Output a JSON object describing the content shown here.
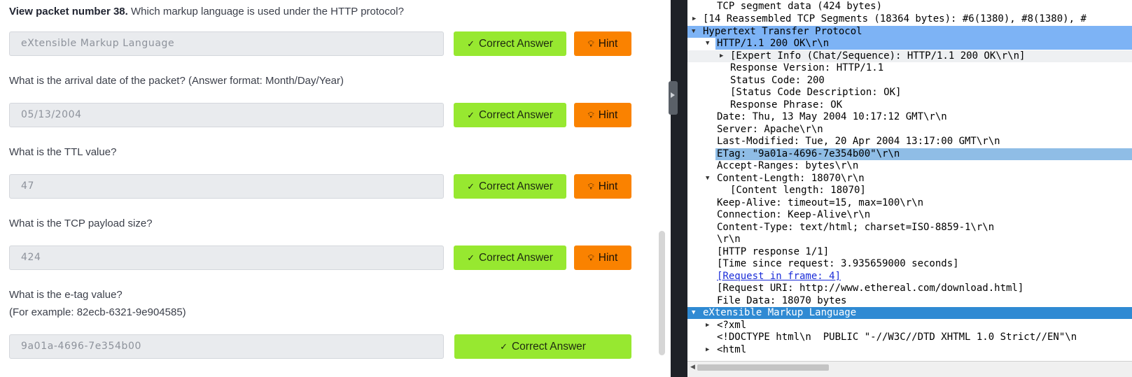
{
  "questions": [
    {
      "prefix": "View packet number 38.",
      "text": " Which markup language is used under the HTTP protocol?",
      "answer": "eXtensible Markup Language",
      "correct_label": "Correct Answer",
      "hint_label": "Hint"
    },
    {
      "text": "What is the arrival date of the packet? (Answer format: Month/Day/Year)",
      "answer": "05/13/2004",
      "correct_label": "Correct Answer",
      "hint_label": "Hint"
    },
    {
      "text": "What is the TTL value?",
      "answer": "47",
      "correct_label": "Correct Answer",
      "hint_label": "Hint"
    },
    {
      "text": "What is the TCP payload size?",
      "answer": "424",
      "correct_label": "Correct Answer",
      "hint_label": "Hint"
    },
    {
      "text": "What is the e-tag value?",
      "subtext": "(For example: 82ecb-6321-9e904585)",
      "answer": "9a01a-4696-7e354b00",
      "correct_label": "Correct Answer"
    }
  ],
  "icons": {
    "check": "check-icon",
    "bulb": "lightbulb-icon",
    "expanded": "triangle-down-icon",
    "collapsed": "triangle-right-icon"
  },
  "colors": {
    "correct": "#97e830",
    "hint": "#fa8200",
    "http_highlight": "#7db3f5",
    "selected": "#8fbde6",
    "xml_highlight": "#2f8ad3"
  },
  "packet_tree": [
    {
      "text": "TCP segment data (424 bytes)"
    },
    {
      "text": "[14 Reassembled TCP Segments (18364 bytes): #6(1380), #8(1380), #"
    },
    {
      "text": "Hypertext Transfer Protocol"
    },
    {
      "text": "HTTP/1.1 200 OK\\r\\n"
    },
    {
      "text": "[Expert Info (Chat/Sequence): HTTP/1.1 200 OK\\r\\n]"
    },
    {
      "text": "Response Version: HTTP/1.1"
    },
    {
      "text": "Status Code: 200"
    },
    {
      "text": "[Status Code Description: OK]"
    },
    {
      "text": "Response Phrase: OK"
    },
    {
      "text": "Date: Thu, 13 May 2004 10:17:12 GMT\\r\\n"
    },
    {
      "text": "Server: Apache\\r\\n"
    },
    {
      "text": "Last-Modified: Tue, 20 Apr 2004 13:17:00 GMT\\r\\n"
    },
    {
      "text": "ETag: \"9a01a-4696-7e354b00\"\\r\\n"
    },
    {
      "text": "Accept-Ranges: bytes\\r\\n"
    },
    {
      "text": "Content-Length: 18070\\r\\n"
    },
    {
      "text": "[Content length: 18070]"
    },
    {
      "text": "Keep-Alive: timeout=15, max=100\\r\\n"
    },
    {
      "text": "Connection: Keep-Alive\\r\\n"
    },
    {
      "text": "Content-Type: text/html; charset=ISO-8859-1\\r\\n"
    },
    {
      "text": "\\r\\n"
    },
    {
      "text": "[HTTP response 1/1]"
    },
    {
      "text": "[Time since request: 3.935659000 seconds]"
    },
    {
      "text": "[Request in frame: 4]"
    },
    {
      "text": "[Request URI: http://www.ethereal.com/download.html]"
    },
    {
      "text": "File Data: 18070 bytes"
    },
    {
      "text": "eXtensible Markup Language"
    },
    {
      "text": "<?xml"
    },
    {
      "text": "<!DOCTYPE html\\n  PUBLIC \"-//W3C//DTD XHTML 1.0 Strict//EN\"\\n"
    },
    {
      "text": "<html"
    }
  ]
}
